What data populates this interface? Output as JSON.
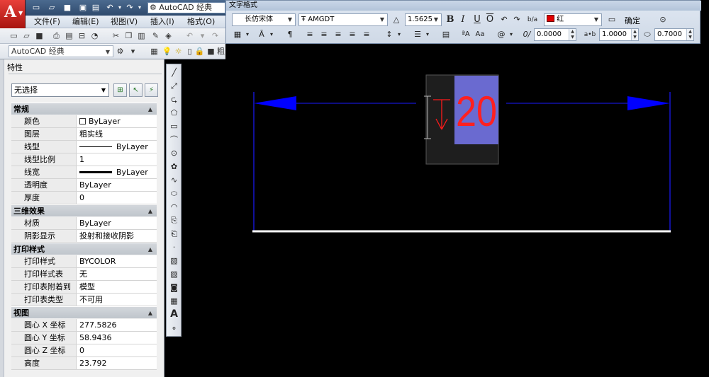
{
  "title_bar": {
    "workspace": "AutoCAD 经典"
  },
  "menu": [
    "文件(F)",
    "编辑(E)",
    "视图(V)",
    "插入(I)",
    "格式(O)"
  ],
  "toolbar2": {
    "workspace_combo": "AutoCAD 经典"
  },
  "text_format": {
    "title": "文字格式",
    "style": "长仿宋体",
    "font": "AMGDT",
    "text_height": "1.5625",
    "color": "红",
    "color_hex": "#e00000",
    "ok": "确定",
    "oblique": "0.0000",
    "tracking": "1.0000",
    "width_factor": "0.7000"
  },
  "properties": {
    "title": "特性",
    "selection": "无选择",
    "sections": [
      {
        "name": "常规",
        "rows": [
          {
            "key": "颜色",
            "value": "ByLayer"
          },
          {
            "key": "图层",
            "value": "粗实线"
          },
          {
            "key": "线型",
            "value": "ByLayer"
          },
          {
            "key": "线型比例",
            "value": "1"
          },
          {
            "key": "线宽",
            "value": "ByLayer"
          },
          {
            "key": "透明度",
            "value": "ByLayer"
          },
          {
            "key": "厚度",
            "value": "0"
          }
        ]
      },
      {
        "name": "三维效果",
        "rows": [
          {
            "key": "材质",
            "value": "ByLayer"
          },
          {
            "key": "阴影显示",
            "value": "投射和接收阴影"
          }
        ]
      },
      {
        "name": "打印样式",
        "rows": [
          {
            "key": "打印样式",
            "value": "BYCOLOR"
          },
          {
            "key": "打印样式表",
            "value": "无"
          },
          {
            "key": "打印表附着到",
            "value": "模型"
          },
          {
            "key": "打印表类型",
            "value": "不可用"
          }
        ]
      },
      {
        "name": "视图",
        "rows": [
          {
            "key": "圆心 X 坐标",
            "value": "277.5826"
          },
          {
            "key": "圆心 Y 坐标",
            "value": "58.9436"
          },
          {
            "key": "圆心 Z 坐标",
            "value": "0"
          },
          {
            "key": "高度",
            "value": "23.792"
          }
        ]
      }
    ]
  },
  "drawing": {
    "dim_text": "20",
    "dimension_color": "#0000ff",
    "text_highlight_color": "#6a6ad0",
    "line_color": "#ffffff"
  }
}
